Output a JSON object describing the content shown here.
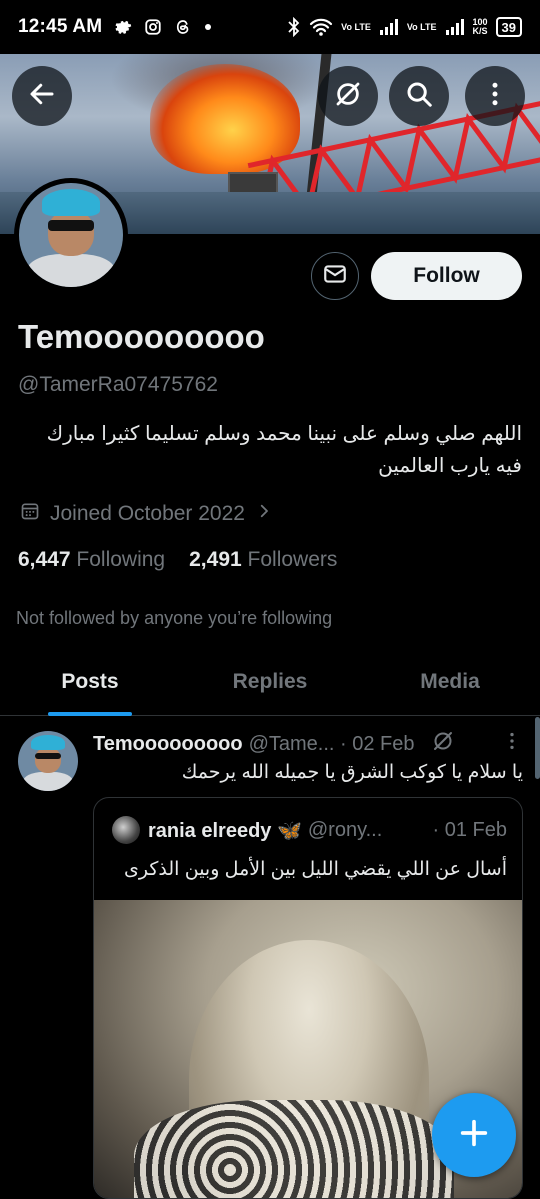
{
  "status_bar": {
    "time": "12:45 AM",
    "left_icons": [
      "gear-icon",
      "instagram-icon",
      "threads-icon",
      "dot-icon"
    ],
    "right_icons": [
      "bluetooth-icon",
      "wifi-icon",
      "volte-signal-icon",
      "volte-signal-icon"
    ],
    "volte_label": "Vo LTE",
    "net_speed_value": "100",
    "net_speed_unit": "K/S",
    "battery": "39"
  },
  "banner": {
    "back_icon": "arrow-left-icon",
    "grok_icon": "grok-icon",
    "search_icon": "search-icon",
    "more_icon": "more-vertical-icon"
  },
  "profile": {
    "display_name": "Temooooooooo",
    "handle": "@TamerRa07475762",
    "bio": "اللهم صلي وسلم على نبينا محمد وسلم تسليما كثيرا مبارك فيه يارب العالمين",
    "joined": "Joined October 2022",
    "following_count": "6,447",
    "following_label": "Following",
    "followers_count": "2,491",
    "followers_label": "Followers",
    "not_followed": "Not followed by anyone you’re following",
    "follow_label": "Follow"
  },
  "tabs": [
    {
      "label": "Posts",
      "active": true
    },
    {
      "label": "Replies",
      "active": false
    },
    {
      "label": "Media",
      "active": false
    }
  ],
  "post": {
    "author": "Temooooooooo",
    "meta": "@Tame... · 02 Feb",
    "text": "يا سلام يا كوكب الشرق يا جميله الله يرحمك",
    "quote": {
      "author": "rania elreedy 🦋",
      "handle": "@rony...",
      "date": "· 01 Feb",
      "text": "أسال عن اللي يقضي الليل بين الأمل وبين الذكرى"
    }
  },
  "fab": {
    "icon": "plus-icon"
  },
  "colors": {
    "accent": "#1d9bf0",
    "background": "#000000",
    "secondary_text": "#71767b"
  }
}
